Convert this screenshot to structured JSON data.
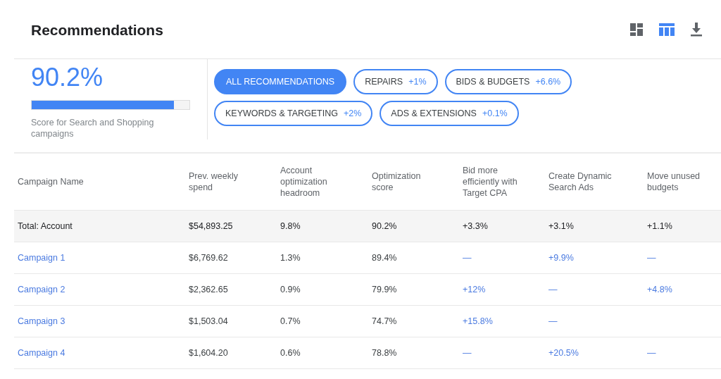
{
  "title": "Recommendations",
  "toolbar": [
    {
      "kind": "dashboard",
      "selected": false
    },
    {
      "kind": "table",
      "selected": true
    },
    {
      "kind": "download",
      "selected": false
    }
  ],
  "score": {
    "value": "90.2%",
    "level": 0.9,
    "caption": "Score for Search and Shopping campaigns"
  },
  "filters": [
    [
      {
        "label": "ALL RECOMMENDATIONS",
        "selected": true
      },
      {
        "label": "REPAIRS",
        "uplift": "+1%",
        "selected": false
      },
      {
        "label": "BIDS & BUDGETS",
        "uplift": "+6.6%",
        "selected": false
      }
    ],
    [
      {
        "label": "KEYWORDS & TARGETING",
        "uplift": "+2%",
        "selected": false
      },
      {
        "label": "ADS & EXTENSIONS",
        "uplift": "+0.1%",
        "selected": false
      }
    ]
  ],
  "table": {
    "columns": [
      {
        "label": "Campaign Name",
        "kind": "name"
      },
      {
        "label": "Prev. weekly spend",
        "kind": "text"
      },
      {
        "label": "Account optimization headroom",
        "kind": "text"
      },
      {
        "label": "Optimization score",
        "kind": "text"
      },
      {
        "label": "Bid more efficiently with Target CPA",
        "kind": "uplift"
      },
      {
        "label": "Create Dynamic Search Ads",
        "kind": "uplift"
      },
      {
        "label": "Move unused budgets",
        "kind": "uplift"
      }
    ],
    "rows": [
      {
        "kind": "total",
        "cells": [
          "Total: Account",
          "$54,893.25",
          "9.8%",
          "90.2%",
          "+3.3%",
          "+3.1%",
          "+1.1%"
        ]
      },
      {
        "kind": "campaign",
        "cells": [
          "Campaign 1",
          "$6,769.62",
          "1.3%",
          "89.4%",
          "—",
          "+9.9%",
          "—"
        ]
      },
      {
        "kind": "campaign",
        "cells": [
          "Campaign 2",
          "$2,362.65",
          "0.9%",
          "79.9%",
          "+12%",
          "—",
          "+4.8%"
        ]
      },
      {
        "kind": "campaign",
        "cells": [
          "Campaign 3",
          "$1,503.04",
          "0.7%",
          "74.7%",
          "+15.8%",
          "—",
          null
        ]
      },
      {
        "kind": "campaign",
        "cells": [
          "Campaign 4",
          "$1,604.20",
          "0.6%",
          "78.8%",
          "—",
          "+20.5%",
          "—"
        ]
      }
    ]
  }
}
